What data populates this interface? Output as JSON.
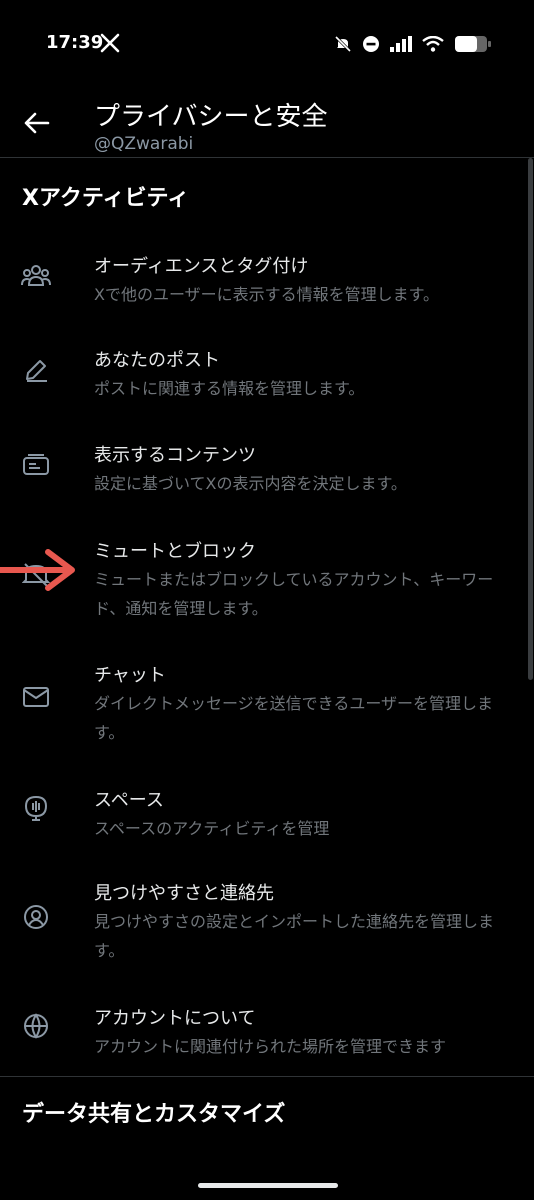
{
  "status": {
    "time": "17:39"
  },
  "header": {
    "title": "プライバシーと安全",
    "handle": "@QZwarabi"
  },
  "sections": [
    {
      "title": "Xアクティビティ"
    },
    {
      "title": "データ共有とカスタマイズ"
    }
  ],
  "items": [
    {
      "icon": "people-icon",
      "title": "オーディエンスとタグ付け",
      "desc": "Xで他のユーザーに表示する情報を管理します。"
    },
    {
      "icon": "pencil-icon",
      "title": "あなたのポスト",
      "desc": "ポストに関連する情報を管理します。"
    },
    {
      "icon": "content-icon",
      "title": "表示するコンテンツ",
      "desc": "設定に基づいてXの表示内容を決定します。"
    },
    {
      "icon": "mute-icon",
      "title": "ミュートとブロック",
      "desc": "ミュートまたはブロックしているアカウント、キーワード、通知を管理します。"
    },
    {
      "icon": "envelope-icon",
      "title": "チャット",
      "desc": "ダイレクトメッセージを送信できるユーザーを管理します。"
    },
    {
      "icon": "spaces-icon",
      "title": "スペース",
      "desc": "スペースのアクティビティを管理"
    },
    {
      "icon": "discover-icon",
      "title": "見つけやすさと連絡先",
      "desc": "見つけやすさの設定とインポートした連絡先を管理します。"
    },
    {
      "icon": "globe-icon",
      "title": "アカウントについて",
      "desc": "アカウントに関連付けられた場所を管理できます"
    }
  ],
  "colors": {
    "annotation_arrow": "#e8584f",
    "muted_text": "#71767b"
  }
}
